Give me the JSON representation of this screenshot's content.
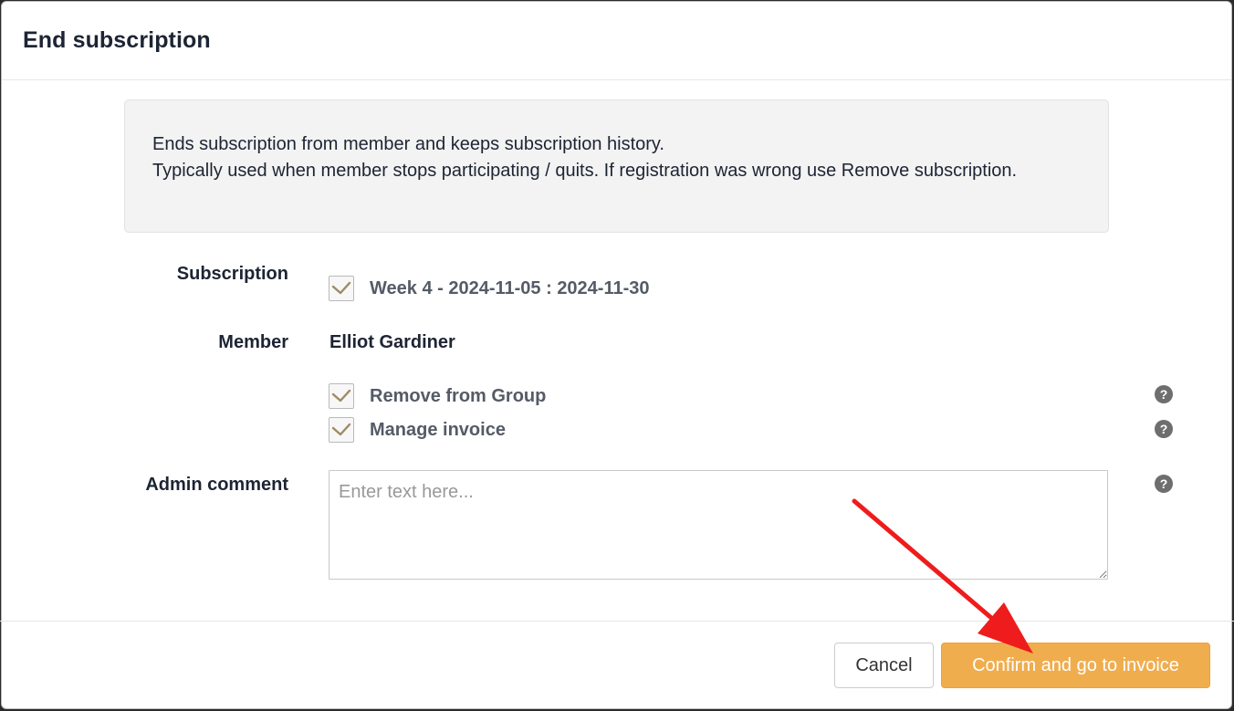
{
  "dialog": {
    "title": "End subscription"
  },
  "info": {
    "line1": "Ends subscription from member and keeps subscription history.",
    "line2": "Typically used when member stops participating / quits. If registration was wrong use Remove subscription."
  },
  "form": {
    "subscription_label": "Subscription",
    "subscription_value": "Week 4 - 2024-11-05 : 2024-11-30",
    "subscription_checked": true,
    "member_label": "Member",
    "member_value": "Elliot Gardiner",
    "remove_from_group_label": "Remove from Group",
    "remove_from_group_checked": true,
    "manage_invoice_label": "Manage invoice",
    "manage_invoice_checked": true,
    "admin_comment_label": "Admin comment",
    "admin_comment_placeholder": "Enter text here...",
    "admin_comment_value": "",
    "help_glyph": "?"
  },
  "footer": {
    "cancel_label": "Cancel",
    "confirm_label": "Confirm and go to invoice"
  },
  "colors": {
    "accent": "#f0ad4e",
    "checkmark": "#a08a63",
    "annotation_arrow": "#ee1c1c"
  },
  "icons": {
    "checkmark": "checkmark-icon",
    "help": "question-circle-icon",
    "annotation": "arrow-icon"
  }
}
